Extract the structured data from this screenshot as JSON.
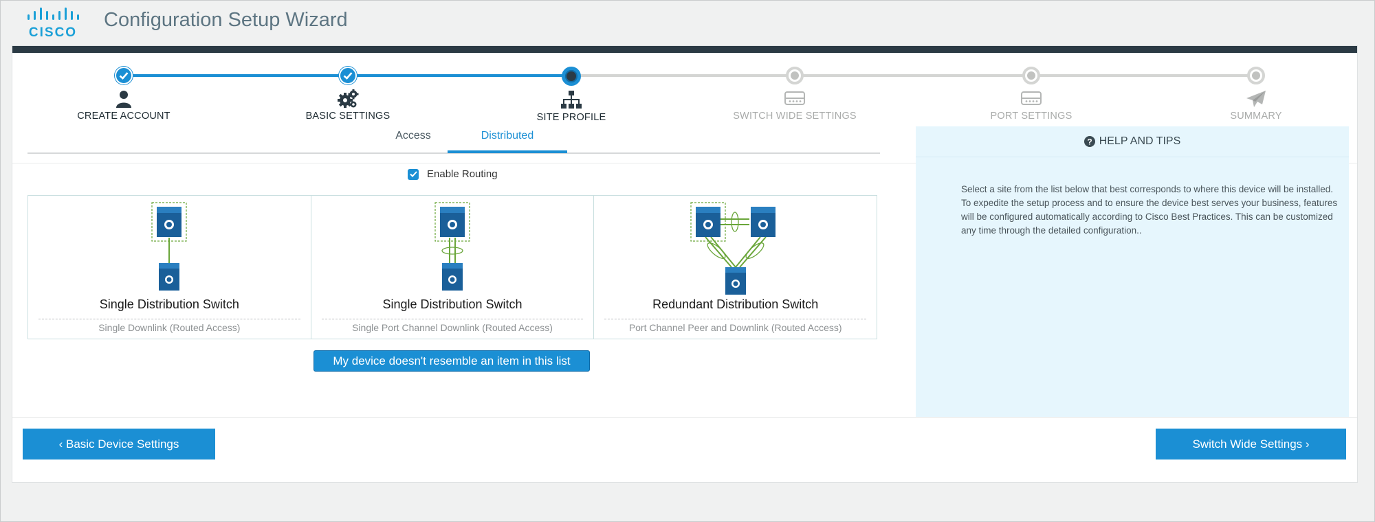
{
  "app": {
    "title": "Configuration Setup Wizard",
    "logo_text": "CISCO"
  },
  "stepper": {
    "steps": [
      {
        "label": "CREATE ACCOUNT",
        "state": "done",
        "icon": "user-icon"
      },
      {
        "label": "BASIC SETTINGS",
        "state": "done",
        "icon": "gears-icon"
      },
      {
        "label": "SITE PROFILE",
        "state": "current",
        "icon": "sitemap-icon"
      },
      {
        "label": "SWITCH WIDE SETTINGS",
        "state": "todo",
        "icon": "switch-icon"
      },
      {
        "label": "PORT SETTINGS",
        "state": "todo",
        "icon": "switch-icon"
      },
      {
        "label": "SUMMARY",
        "state": "todo",
        "icon": "paper-plane-icon"
      }
    ]
  },
  "tabs": [
    {
      "label": "Access",
      "active": false
    },
    {
      "label": "Distributed",
      "active": true
    }
  ],
  "routing": {
    "label": "Enable Routing",
    "checked": true
  },
  "options": [
    {
      "title": "Single Distribution Switch",
      "subtitle": "Single Downlink (Routed Access)"
    },
    {
      "title": "Single Distribution Switch",
      "subtitle": "Single Port Channel Downlink (Routed Access)"
    },
    {
      "title": "Redundant Distribution Switch",
      "subtitle": "Port Channel Peer and Downlink (Routed Access)"
    }
  ],
  "resemble_button": "My device doesn't resemble an item in this list",
  "help": {
    "title": "HELP AND TIPS",
    "text": "Select a site from the list below that best corresponds to where this device will be installed. To expedite the setup process and to ensure the device best serves your business, features will be configured automatically according to Cisco Best Practices. This can be customized any time through the detailed configuration.."
  },
  "footer": {
    "back_label": "‹ Basic Device Settings",
    "next_label": "Switch Wide Settings ›"
  },
  "colors": {
    "accent": "#1b8fd4",
    "dark": "#2b3a44",
    "help_bg": "#e6f6fd",
    "link_green": "#6aa63a"
  }
}
